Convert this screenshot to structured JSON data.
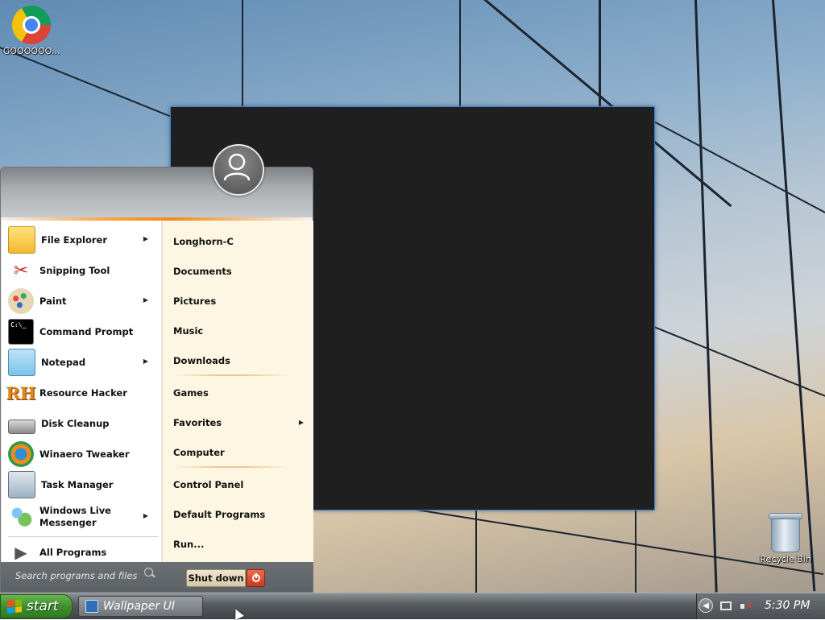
{
  "desktop": {
    "icons": [
      {
        "label": "GOOOOOO...",
        "icon": "chrome-icon"
      },
      {
        "label": "Recycle Bin",
        "icon": "recycle-bin-icon"
      }
    ]
  },
  "start_menu": {
    "user_icon": "user-avatar-icon",
    "programs": [
      {
        "label": "File Explorer",
        "icon": "folder-icon",
        "submenu": true
      },
      {
        "label": "Snipping Tool",
        "icon": "scissors-icon",
        "submenu": false
      },
      {
        "label": "Paint",
        "icon": "paint-palette-icon",
        "submenu": true
      },
      {
        "label": "Command Prompt",
        "icon": "terminal-icon",
        "submenu": false
      },
      {
        "label": "Notepad",
        "icon": "notepad-icon",
        "submenu": true
      },
      {
        "label": "Resource Hacker",
        "icon": "rh-icon",
        "submenu": false
      },
      {
        "label": "Disk Cleanup",
        "icon": "disk-cleanup-icon",
        "submenu": false
      },
      {
        "label": "Winaero Tweaker",
        "icon": "tweaker-icon",
        "submenu": false
      },
      {
        "label": "Task Manager",
        "icon": "task-manager-icon",
        "submenu": false
      },
      {
        "label_line1": "Windows Live",
        "label_line2": "Messenger",
        "icon": "messenger-icon",
        "submenu": true
      }
    ],
    "all_programs": "All Programs",
    "places": [
      {
        "label": "Longhorn-C"
      },
      {
        "label": "Documents"
      },
      {
        "label": "Pictures"
      },
      {
        "label": "Music"
      },
      {
        "label": "Downloads"
      },
      {
        "label": "Games"
      },
      {
        "label": "Favorites",
        "submenu": true
      },
      {
        "label": "Computer"
      },
      {
        "label": "Control Panel"
      },
      {
        "label": "Default Programs"
      },
      {
        "label": "Run..."
      }
    ],
    "search_placeholder": "Search programs and files",
    "shutdown_label": "Shut down"
  },
  "taskbar": {
    "start_label": "start",
    "window_button": "Wallpaper UI",
    "clock": "5:30 PM"
  },
  "colors": {
    "start_green": "#3f8f2e",
    "accent_orange": "#f28a1b",
    "places_bg": "#fdf6e2",
    "dark_window": "#1f1f1f"
  }
}
